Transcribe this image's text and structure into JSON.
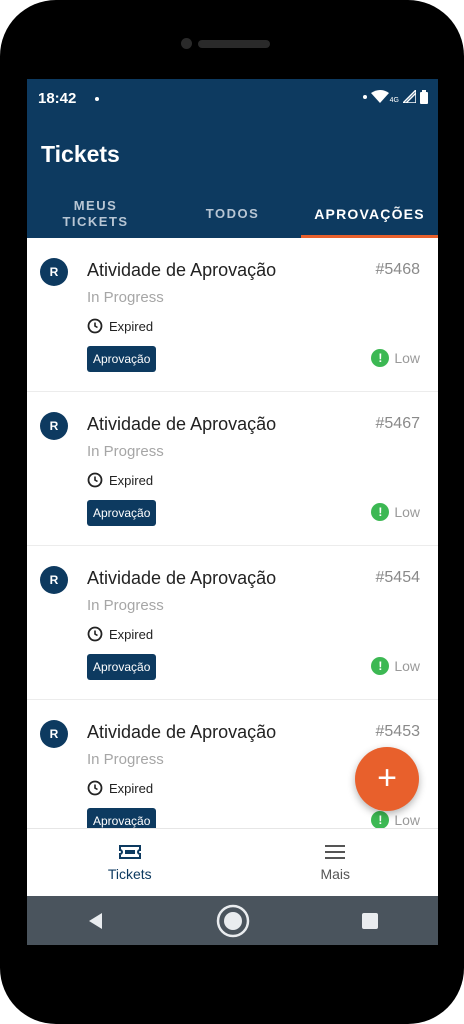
{
  "status_bar": {
    "time": "18:42",
    "network_label": "4G"
  },
  "app_bar": {
    "title": "Tickets",
    "tabs": [
      {
        "label": "MEUS\nTICKETS",
        "active": false
      },
      {
        "label": "TODOS",
        "active": false
      },
      {
        "label": "APROVAÇÕES",
        "active": true
      }
    ]
  },
  "tickets": [
    {
      "avatar": "R",
      "title": "Atividade de Aprovação",
      "id": "#5468",
      "status": "In Progress",
      "expired": "Expired",
      "tag": "Aprovação",
      "priority": "Low",
      "priority_icon": "!"
    },
    {
      "avatar": "R",
      "title": "Atividade de Aprovação",
      "id": "#5467",
      "status": "In Progress",
      "expired": "Expired",
      "tag": "Aprovação",
      "priority": "Low",
      "priority_icon": "!"
    },
    {
      "avatar": "R",
      "title": "Atividade de Aprovação",
      "id": "#5454",
      "status": "In Progress",
      "expired": "Expired",
      "tag": "Aprovação",
      "priority": "Low",
      "priority_icon": "!"
    },
    {
      "avatar": "R",
      "title": "Atividade de Aprovação",
      "id": "#5453",
      "status": "In Progress",
      "expired": "Expired",
      "tag": "Aprovação",
      "priority": "Low",
      "priority_icon": "!"
    }
  ],
  "fab": {
    "label": "+"
  },
  "bottom_nav": [
    {
      "label": "Tickets",
      "icon": "ticket-icon",
      "active": true
    },
    {
      "label": "Mais",
      "icon": "menu-icon",
      "active": false
    }
  ],
  "colors": {
    "primary": "#0d3a60",
    "accent": "#e8602c",
    "priority_low": "#3cb853"
  }
}
